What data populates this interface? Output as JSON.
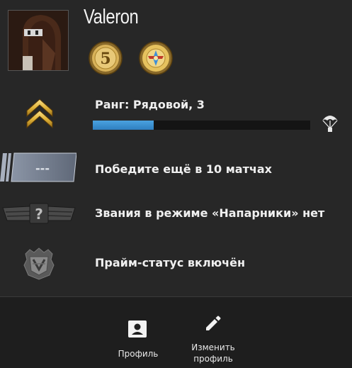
{
  "profile": {
    "username": "Valeron",
    "avatar_icon": "player-avatar",
    "coins": [
      {
        "icon": "service-medal-5-icon"
      },
      {
        "icon": "operation-coin-icon"
      }
    ]
  },
  "rank": {
    "label": "Ранг: Рядовой, 3",
    "icon": "rank-chevron-icon",
    "xp_progress": 0.28,
    "xp_bar_color": "#3a90d0",
    "drop_icon": "parachute-icon"
  },
  "competitive": {
    "icon": "skill-group-placeholder-icon",
    "placeholder_rank": "---",
    "text": "Победите ещё в 10 матчах"
  },
  "wingman": {
    "icon": "wingman-unknown-rank-icon",
    "text": "Звания в режиме «Напарники» нет"
  },
  "prime": {
    "icon": "prime-badge-icon",
    "text": "Прайм-статус включён"
  },
  "footer": {
    "profile_label": "Профиль",
    "profile_icon": "profile-card-icon",
    "edit_label": "Изменить профиль",
    "edit_icon": "pencil-icon"
  },
  "colors": {
    "background": "#272727",
    "footer_background": "#1e1e1e",
    "rank_gold": "#e0b33a"
  }
}
